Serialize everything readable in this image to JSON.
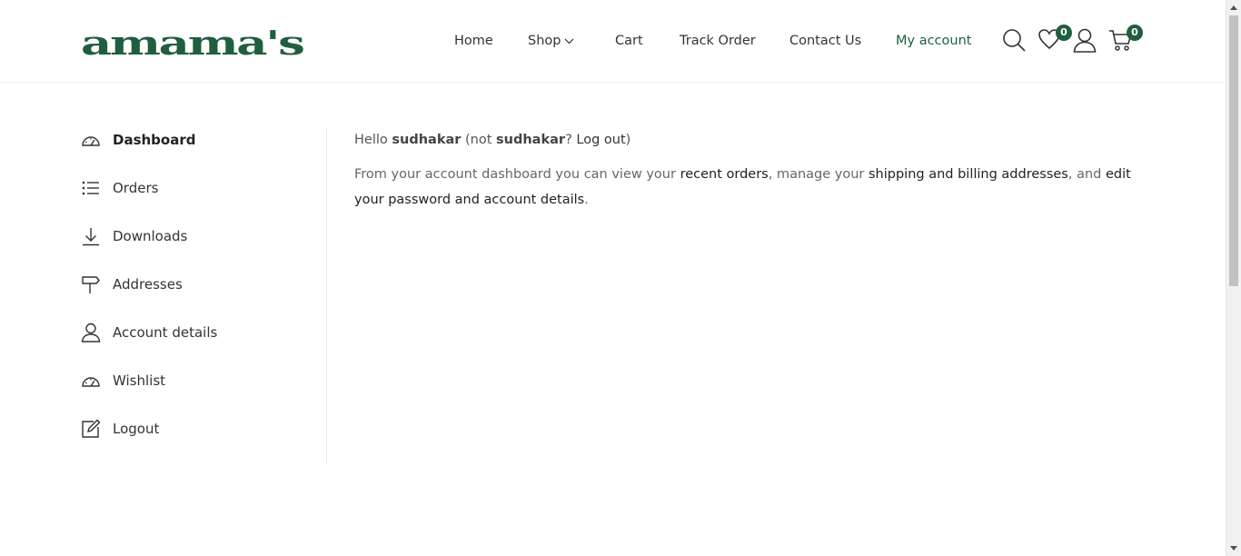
{
  "logo": {
    "text": "amama's"
  },
  "nav": {
    "items": [
      {
        "label": "Home"
      },
      {
        "label": "Shop"
      },
      {
        "label": "Cart"
      },
      {
        "label": "Track Order"
      },
      {
        "label": "Contact Us"
      },
      {
        "label": "My account"
      }
    ]
  },
  "header_icons": {
    "wishlist_count": "0",
    "cart_count": "0"
  },
  "sidebar": {
    "items": [
      {
        "label": "Dashboard",
        "icon": "dashboard-icon"
      },
      {
        "label": "Orders",
        "icon": "list-icon"
      },
      {
        "label": "Downloads",
        "icon": "download-icon"
      },
      {
        "label": "Addresses",
        "icon": "signpost-icon"
      },
      {
        "label": "Account details",
        "icon": "user-icon"
      },
      {
        "label": "Wishlist",
        "icon": "dashboard-icon"
      },
      {
        "label": "Logout",
        "icon": "edit-icon"
      }
    ]
  },
  "content": {
    "hello_prefix": "Hello ",
    "username": "sudhakar",
    "not_prefix": " (not ",
    "username2": "sudhakar",
    "question": "? ",
    "logout_link": "Log out",
    "close_paren": ")",
    "para_1": "From your account dashboard you can view your ",
    "recent_orders": "recent orders",
    "para_2": ", manage your ",
    "addresses_link": "shipping and billing addresses",
    "para_3": ", and ",
    "edit_link": "edit your password and account details",
    "para_4": "."
  },
  "colors": {
    "brand": "#1f5f3f"
  }
}
